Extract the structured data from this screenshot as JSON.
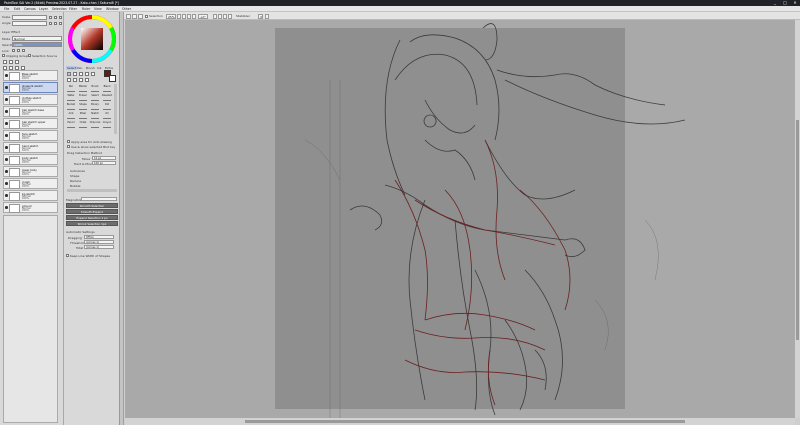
{
  "window": {
    "title": "PaintTool SAI Ver.2 (64bit) Preview.2023.07.27 - Kato-chan / Sakurai8 [*]",
    "controls": [
      "_",
      "□",
      "✕"
    ]
  },
  "menu": [
    "File",
    "Edit",
    "Canvas",
    "Layer",
    "Selection",
    "Filter",
    "Ruler",
    "View",
    "Window",
    "Other",
    "Help"
  ],
  "toolbar": {
    "selection_label": "Selection",
    "zoom_value": "25%",
    "angle_value": "+0°",
    "stabilizer_label": "Stabilizer",
    "stabilizer_value": "3"
  },
  "left_panel": {
    "scale_label": "Scale",
    "angle_label": "Angle",
    "layer_effect_label": "Layer Effect",
    "mode_label": "Mode",
    "mode_value": "Normal",
    "opacity_label": "Opacity",
    "opacity_value": "100%",
    "lock_label": "Lock",
    "clipping_label": "Clipping Group",
    "selection_source_label": "Selection Source",
    "layers": [
      {
        "name": "Base sketch",
        "mode": "Normal",
        "opacity": "100%"
      },
      {
        "name": "linework sketch",
        "mode": "Normal",
        "opacity": "100%"
      },
      {
        "name": "clothes sketch",
        "mode": "Normal",
        "opacity": "100%"
      },
      {
        "name": "hair sketch base",
        "mode": "Normal",
        "opacity": "100%"
      },
      {
        "name": "hair sketch upper",
        "mode": "Normal",
        "opacity": "100%"
      },
      {
        "name": "face sketch",
        "mode": "Normal",
        "opacity": "100%"
      },
      {
        "name": "hand sketch",
        "mode": "Normal",
        "opacity": "100%"
      },
      {
        "name": "body sketch",
        "mode": "Normal",
        "opacity": "100%"
      },
      {
        "name": "lower body",
        "mode": "Normal",
        "opacity": "100%"
      },
      {
        "name": "rough",
        "mode": "Normal",
        "opacity": "100%"
      },
      {
        "name": "bg sketch",
        "mode": "Normal",
        "opacity": "100%"
      },
      {
        "name": "ground",
        "mode": "Normal",
        "opacity": "100%"
      }
    ],
    "selected_layer_index": 1
  },
  "mid_panel": {
    "tabs": [
      "Select",
      "Pen",
      "Brush",
      "Ink",
      "Extra"
    ],
    "brushes": [
      [
        "Pen",
        "Marker",
        "Brush",
        "Blend"
      ],
      [
        "Water",
        "Eraser",
        "Select",
        "Deselect"
      ],
      [
        "Bucket",
        "Shape",
        "Binary",
        "Dot"
      ],
      [
        "Airb",
        "Mixer",
        "Sketch",
        "Oil"
      ],
      [
        "Pencil",
        "Chalk",
        "Charcoal",
        "Crayon"
      ]
    ],
    "apply_label": "Apply area for Anti-aliasing",
    "sample_label": "Use & show selected Blot key",
    "detect_label": "Drag Detection Method",
    "width_label": "Move",
    "width_value": "10 px",
    "inner_label": "Hard & Move",
    "inner_value": "100 px",
    "radio_options": [
      "Auto/Area",
      "Shape",
      "Reduce",
      "Bubble"
    ],
    "magnetize_label": "Magnetize",
    "buttons": [
      "Smooth Selection",
      "Smooth Expand",
      "Expand Selection 1 px",
      "Shrink Selection 1px"
    ],
    "auto_settings_label": "Automatic Settings",
    "dragging_label": "Dragging",
    "dragging_value": "Off/on",
    "threshold_label": "Threshold",
    "threshold_value": "(Across 1)",
    "total_label": "Total",
    "total_value": "(Across 1)",
    "keep_label": "Keep Line Width of Shapes"
  },
  "colors": {
    "primary": "#6b1a12",
    "secondary": "#ffffff",
    "accent_blue": "#3a6fd8"
  }
}
